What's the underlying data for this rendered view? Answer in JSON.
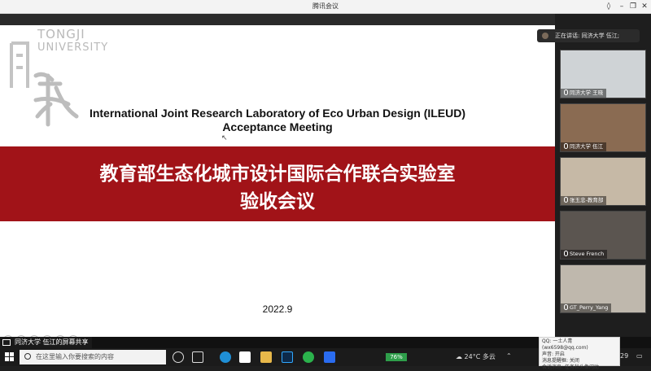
{
  "window": {
    "title": "腾讯会议"
  },
  "slide": {
    "logo_line1": "TONGJI",
    "logo_line2": "UNIVERSITY",
    "en_title_1": "International Joint Research Laboratory of Eco Urban Design (ILEUD)",
    "en_title_2": "Acceptance Meeting",
    "cn_title_1": "教育部生态化城市设计国际合作联合实验室",
    "cn_title_2": "验收会议",
    "date": "2022.9"
  },
  "speaking": {
    "text": "正在讲话: 同济大学 伍江;"
  },
  "participants": [
    {
      "name": "同济大学 王晓",
      "bg": "#cfd3d6"
    },
    {
      "name": "同济大学 伍江",
      "bg": "#8a6b52"
    },
    {
      "name": "张玉忠-教育部",
      "bg": "#c6b9a6"
    },
    {
      "name": "Steve French",
      "bg": "#5b5550"
    },
    {
      "name": "GT_Perry_Yang",
      "bg": "#bfb8ad"
    }
  ],
  "share": {
    "label": "同济大学 伍江的屏幕共享"
  },
  "notification": {
    "line1": "QQ: 一土人青(wx6598@qq.com)",
    "line2": "声音: 开启",
    "line3": "消息提醒框: 关闭",
    "line4": "会话消息: 任务栏头像闪动"
  },
  "taskbar": {
    "search_placeholder": "在这里输入你要搜索的内容",
    "battery": "76%",
    "weather": "24°C 多云",
    "tray_time": "29"
  },
  "colors": {
    "accent_red": "#a11318",
    "panel_bg": "#1e1e1e"
  }
}
